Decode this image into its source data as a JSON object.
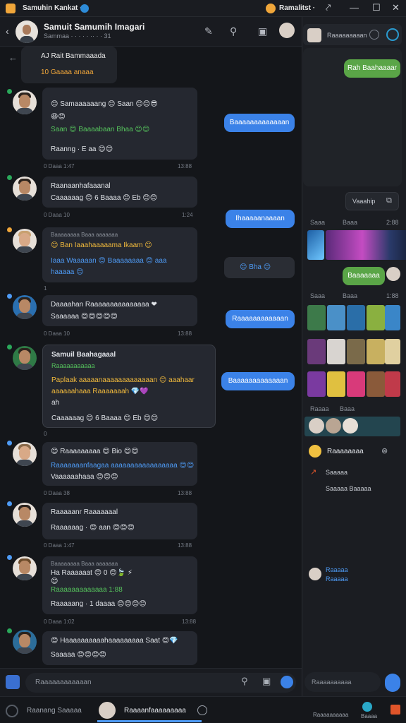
{
  "titlebar": {
    "left_title": "Samuhin Kankat ·",
    "right_title": "Ramalitst ·",
    "minimize": "—",
    "maximize": "☐",
    "close": "✕"
  },
  "chat_header": {
    "name": "Samuit Samumih Imagari",
    "subtitle": "Sammaa · · · · · ·· · · 31"
  },
  "reply_preview": {
    "line1": "AJ  Rait Bammaaada",
    "line2": "10  Gaaaa anaaa"
  },
  "messages": [
    {
      "line1": "😊 Samaaaaaang 😊 Saan 😊😊😎",
      "line2": "😆😊",
      "line3": "Saan 😊 Baaaabaan Bhaa 😊😊",
      "line4": "Raanng · E aa 😊😊",
      "meta": "0 Daaa 1:47",
      "time": "13:88"
    },
    {
      "line1": "Raanaanhafaaanal",
      "line2": "Caaaaaag 😊 6 Baaaa 😊 Eb 😊😊",
      "meta": "0 Daaa 10",
      "time": "1:24"
    },
    {
      "line1": "Baaaaaaaa Baaa aaaaaaa",
      "line2": "😊 Ban  Iaaahaaaaama Ikaam 😊",
      "line3": "Iaaa  Waaaaan  😊 Baaaaaaaa  😊 aaa",
      "line4": "haaaaa 😊",
      "meta": "1",
      "time": ""
    },
    {
      "line1": "Daaaahan Raaaaaaaaaaaaaaa ❤",
      "line2": "Saaaaaa 😊😊😊😊😊",
      "meta": "0 Daaa 10",
      "time": "13:88"
    },
    {
      "line1": "Samuil Baahagaaal",
      "line2": "Raaaaaaaaaaa",
      "line3": "Paplaak aaaaanaaaaaaaaaaaaan 😊 aaahaar",
      "line4": "aaaaaahaaa Raaaaaaah 💎💜",
      "line5": "ah",
      "meta": "0",
      "time": ""
    },
    {
      "line1": "😊 Raaaaaaaaa 😊 Bio 😊😊",
      "line2": "Raaaaaaanfaagaa aaaaaaaaaaaaaaaaa 😊😊",
      "line3": "Vaaaaaahaaa 😊😊😊",
      "meta": "0 Daaa 38",
      "time": "13:88"
    },
    {
      "line1": "Raaaaanr Raaaaaaal",
      "line2": "Raaaaaag · 😊 aan 😊😊😊",
      "meta": "0 Daaa 1:47",
      "time": "13:88"
    },
    {
      "line1": "Ha Raaaaaat 😊 0 😊🍃  ⚡",
      "line2": "😊",
      "line3": "Raaaaaaaaaaaaa 1:88",
      "line4": "Raaaaang · 1 daaaa 😊😊😊😊",
      "meta": "0 Daaa 1:02",
      "time": "13:88"
    },
    {
      "line1": "😊 Haaaaaaaaaahaaaaaaaaa Saat 😊💎",
      "line2": "Saaaaa 😊😊😊😊",
      "meta": "",
      "time": ""
    }
  ],
  "sent_messages": [
    "Baaaaaaaaaaaaan",
    "Ihaaaaanaaaan",
    "😊 Bha 😊",
    "Raaaaaaaaaaaan",
    "Baaaaaaaaaaaaan"
  ],
  "composer": {
    "placeholder": "Raaaaaaaaaaaan"
  },
  "bottom_bar": {
    "tab1": "Raanang  Saaaaa",
    "tab2": "Raaaanfaaaaaaaaa",
    "right1": "Raaaaaaaaaa",
    "right2": "Baaaa"
  },
  "right_panel": {
    "top_label": "Raaaaaaaaan",
    "bubble1": "Rah Baahaaaar",
    "button": "Vaaahip",
    "section1_label": "Saaa",
    "section1_sub": "Baaa",
    "section1_time": "2:88",
    "bubble2": "Baaaaaaa",
    "section2_label": "Saaa",
    "section2_sub": "Baaa",
    "section2_time": "1:88",
    "section3_label": "Raaaa",
    "section3_sub": "Baaa",
    "item1": "Raaaaaaaa",
    "item2": "Saaaaa",
    "item3": "Saaaaa Baaaaa",
    "bottom_item1": "Raaaaa",
    "bottom_item2": "Raaaaa",
    "input_placeholder": "Raaaaaaaaaa"
  },
  "colors": {
    "accent_blue": "#3b82e8",
    "accent_green": "#5aa547",
    "highlight_yellow": "#f0b93c"
  }
}
